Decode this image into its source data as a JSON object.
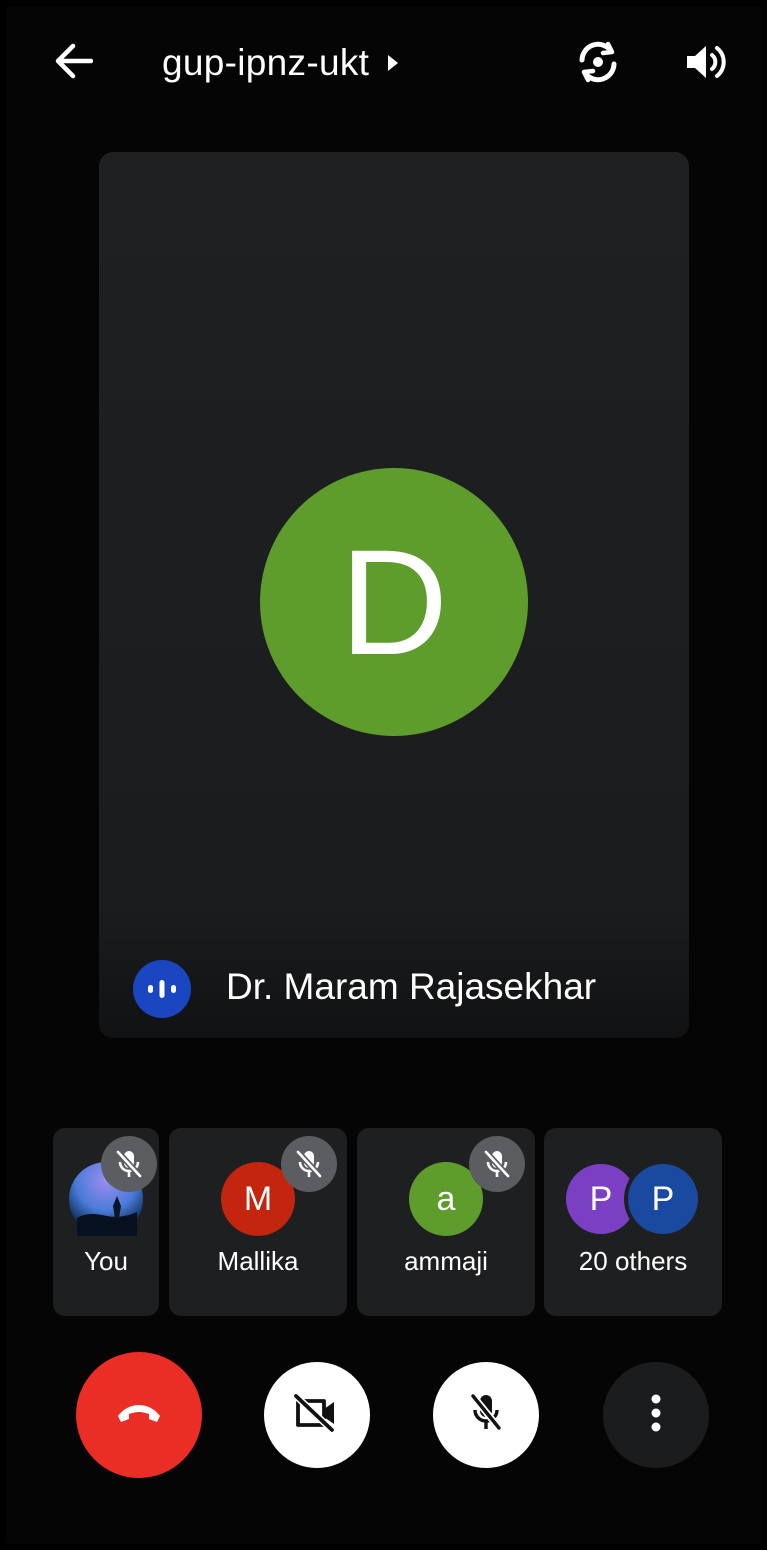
{
  "header": {
    "meeting_code": "gup-ipnz-ukt",
    "back_icon": "arrow-left-icon",
    "caret_icon": "caret-right-icon",
    "switch_camera_icon": "switch-camera-icon",
    "speaker_icon": "volume-icon"
  },
  "main_participant": {
    "initial": "D",
    "name": "Dr. Maram Rajasekhar",
    "avatar_color": "#5e9c2b",
    "speaking_indicator_color": "#1b46c2"
  },
  "participants": [
    {
      "label": "You",
      "avatar": "photo",
      "muted": true
    },
    {
      "label": "Mallika",
      "initial": "M",
      "avatar_color": "#c3250f",
      "muted": true
    },
    {
      "label": "ammaji",
      "initial": "a",
      "avatar_color": "#5e9c2b",
      "muted": true
    },
    {
      "label": "20 others",
      "initials": [
        "P",
        "P"
      ],
      "avatar_colors": [
        "#7b3fc4",
        "#1a4aa0"
      ]
    }
  ],
  "controls": {
    "end_call_icon": "phone-hangup-icon",
    "end_call_color": "#ea2d25",
    "camera_icon": "video-off-icon",
    "mic_icon": "mic-off-icon",
    "more_icon": "more-vertical-icon"
  }
}
